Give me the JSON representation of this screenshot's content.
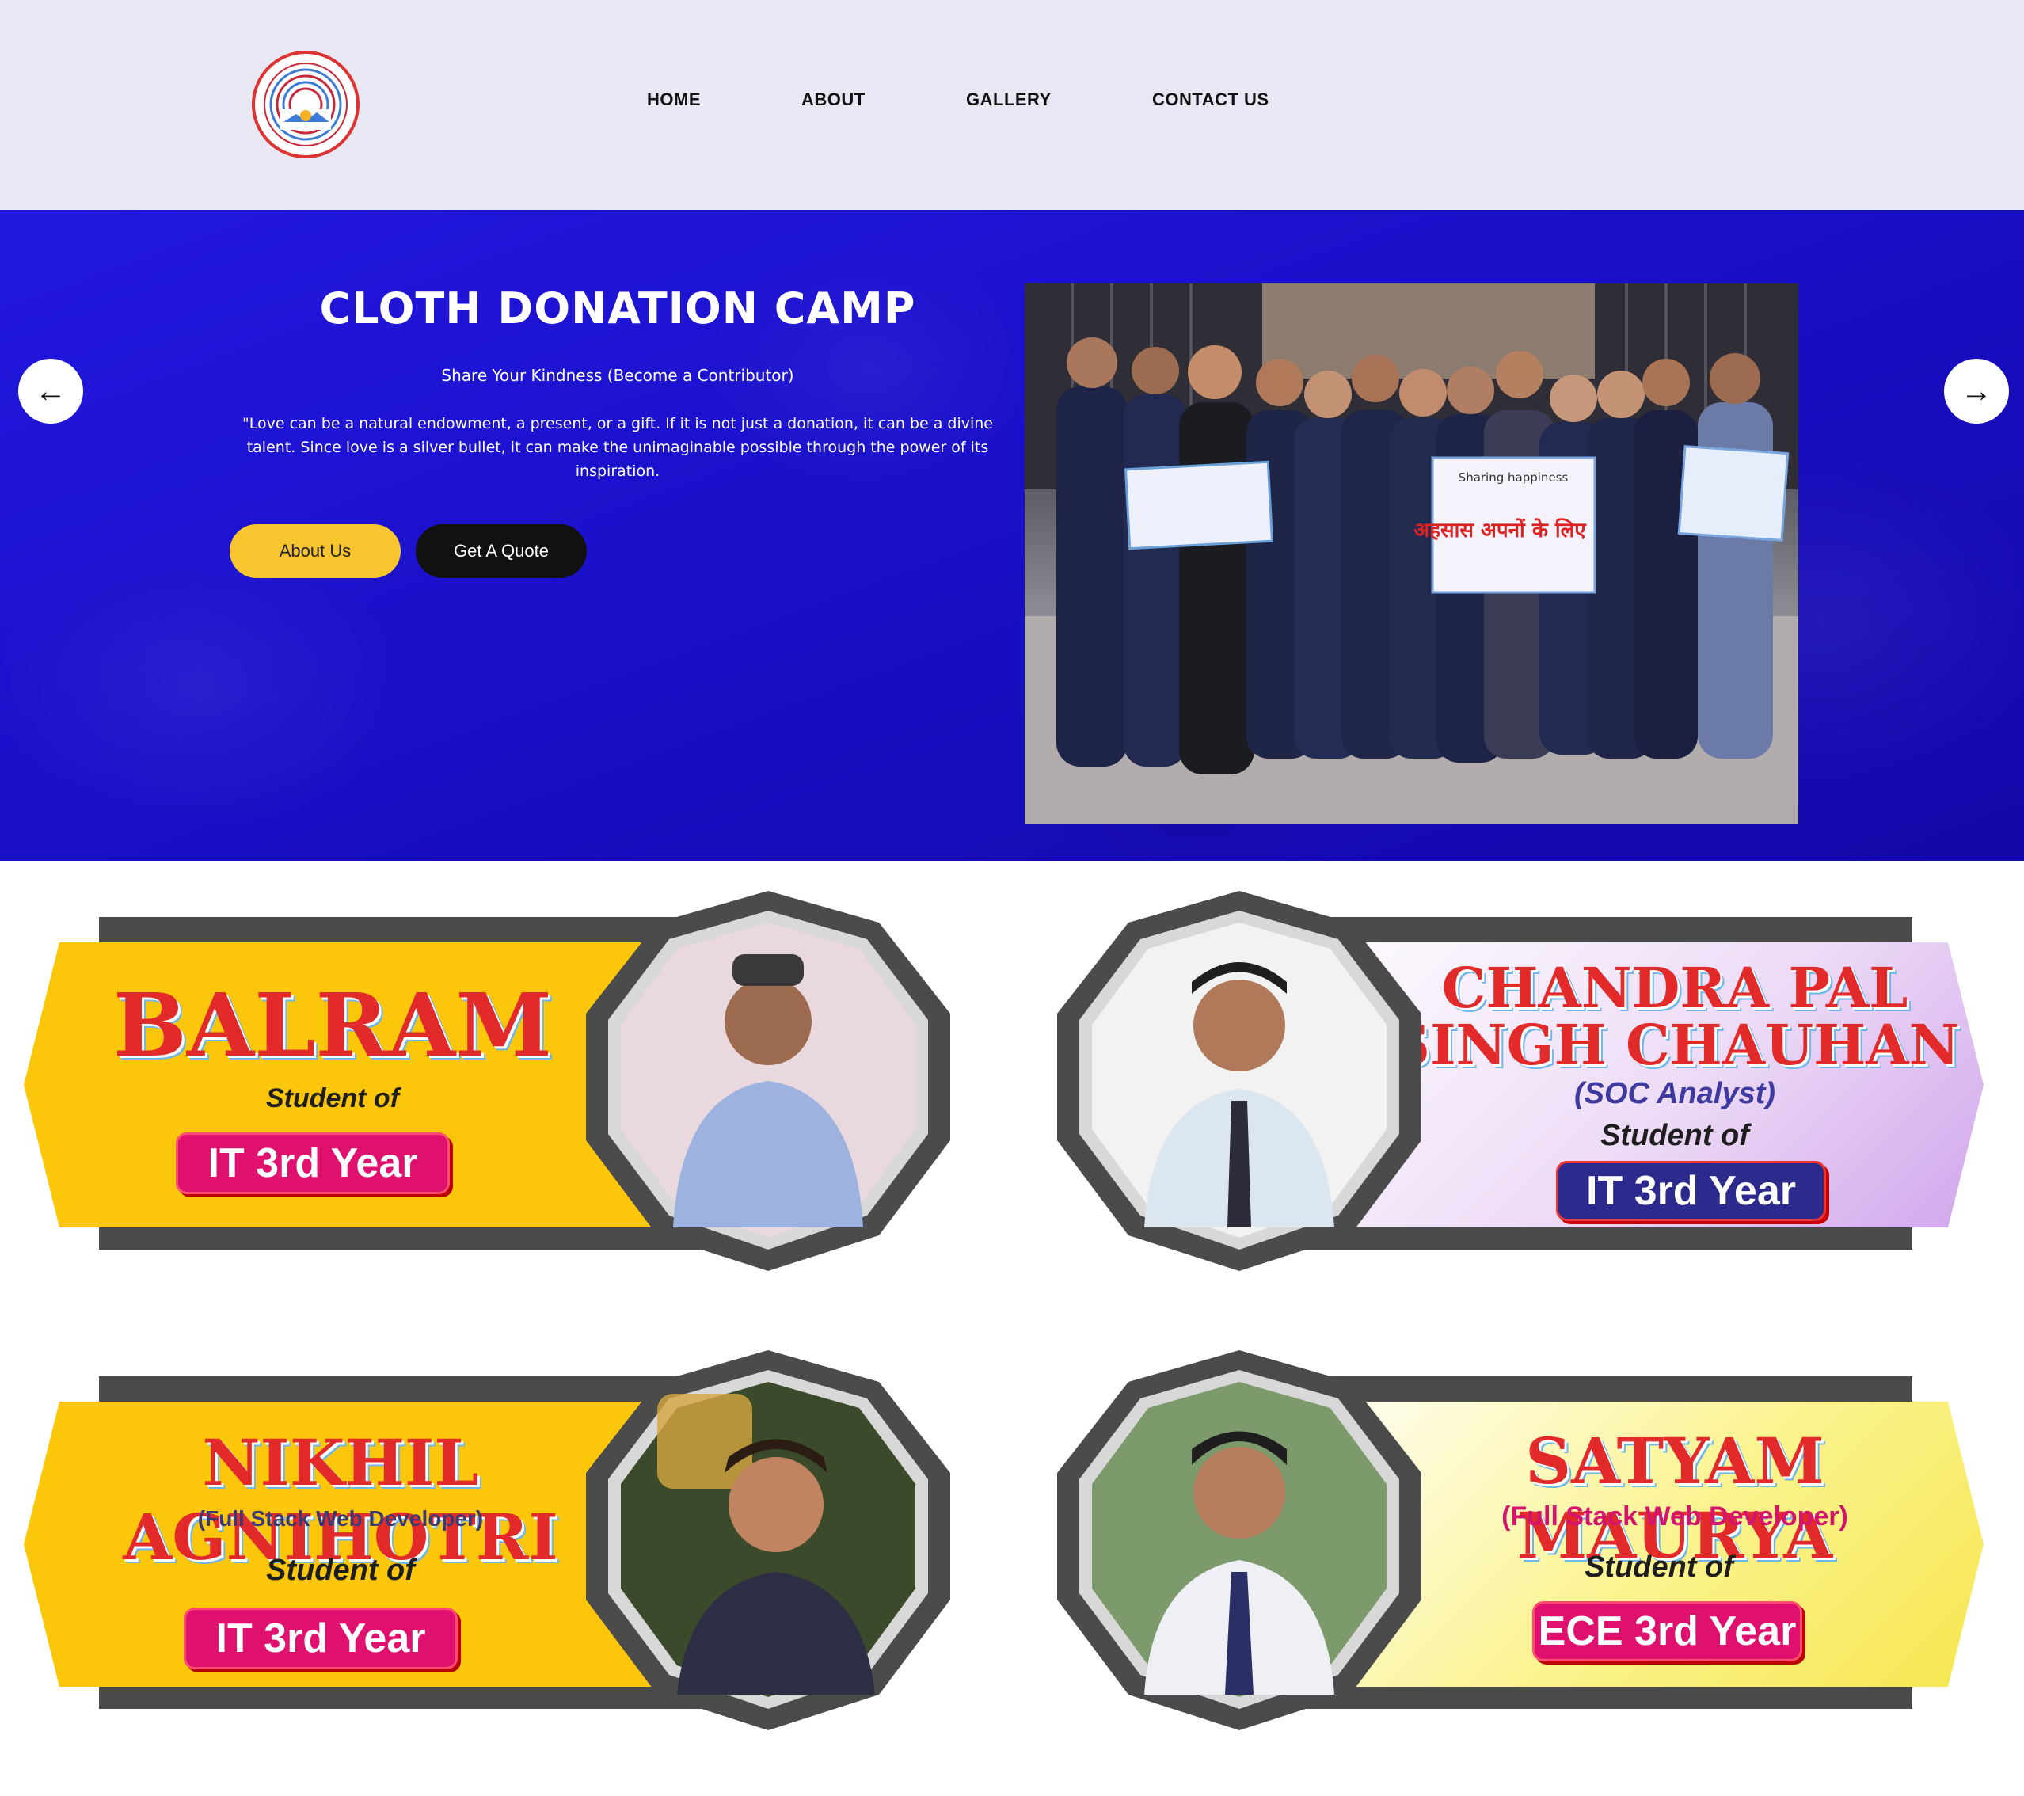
{
  "header": {
    "logo_alt": "Dr. Rammanohar Lohia Avadh University",
    "nav": [
      {
        "label": "HOME"
      },
      {
        "label": "ABOUT"
      },
      {
        "label": "GALLERY"
      },
      {
        "label": "CONTACT US"
      }
    ]
  },
  "hero": {
    "title": "CLOTH DONATION CAMP",
    "subtitle": "Share Your Kindness (Become a Contributor)",
    "quote": "\"Love can be a natural endowment, a present, or a gift. If it is not just a donation, it can be a divine talent. Since love is a silver bullet, it can make the unimaginable possible through the power of its inspiration.",
    "buttons": {
      "about": "About Us",
      "quote": "Get A Quote"
    },
    "photo_banner_text": "Sharing happiness",
    "photo_banner_hindi": "अहसास अपनों के लिए",
    "colors": {
      "background": "#1a10c8",
      "about_btn": "#f7c52d",
      "quote_btn": "#111111"
    }
  },
  "students": [
    {
      "name": "BALRAM",
      "spec": "",
      "role": "Student of",
      "year": "IT 3rd Year",
      "banner_color": "#fcc70a",
      "tag_color": "#e0116e"
    },
    {
      "name_line1": "CHANDRA PAL",
      "name_line2": "SINGH CHAUHAN",
      "spec": "(SOC Analyst)",
      "role": "Student of",
      "year": "IT 3rd Year",
      "banner_color": "#e9d9f4",
      "tag_color": "#2c2a8c"
    },
    {
      "name": "NIKHIL AGNIHOTRI",
      "spec": "(Full Stack Web Developer)",
      "role": "Student of",
      "year": "IT 3rd Year",
      "banner_color": "#fcc70a",
      "tag_color": "#e0116e"
    },
    {
      "name": "SATYAM MAURYA",
      "spec": "(Full Stack Web Developer)",
      "role": "Student of",
      "year": "ECE 3rd Year",
      "banner_color": "#fbf27a",
      "tag_color": "#e0116e"
    }
  ]
}
